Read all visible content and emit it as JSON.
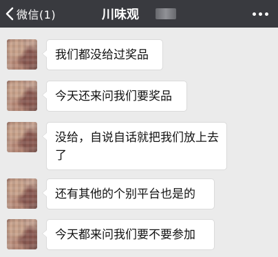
{
  "header": {
    "back_label": "微信(1)",
    "title": "川味观",
    "colors": {
      "bar": "#393a3f",
      "text": "#ffffff"
    }
  },
  "messages": [
    {
      "text": "我们都没给过奖品"
    },
    {
      "text": "今天还来问我们要奖品"
    },
    {
      "text": "没给，自说自话就把我们放上去了"
    },
    {
      "text": "还有其他的个别平台也是的"
    },
    {
      "text": "今天都来问我们要不要参加"
    }
  ],
  "colors": {
    "chat_bg": "#ebebeb",
    "bubble_bg": "#ffffff",
    "bubble_border": "#dadada"
  }
}
